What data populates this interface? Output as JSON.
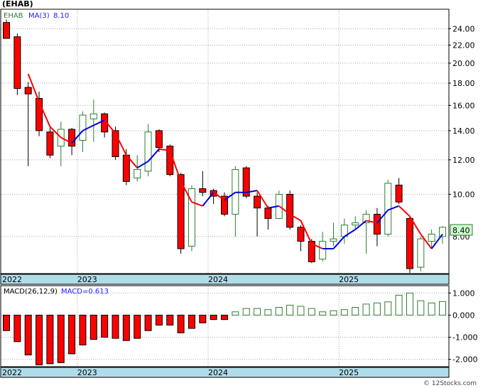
{
  "header": {
    "ticker_title": "(EHAB)"
  },
  "watermark": "© 12Stocks.com",
  "colors": {
    "up_stroke": "#2e7d32",
    "down_fill": "#ff0000",
    "ma_down": "#ff0000",
    "ma_up": "#0000dd",
    "axis_band": "#b0dcea",
    "macd_label": "#1a1aff"
  },
  "chart_data": [
    {
      "type": "candlestick",
      "legend": {
        "symbol": "EHAB",
        "ma_label": "MA(3)",
        "ma_value": "8.10"
      },
      "y_scale": "log",
      "ylim": [
        6.6,
        26.5
      ],
      "yticks": [
        "24.00",
        "22.00",
        "20.00",
        "18.00",
        "16.00",
        "14.00",
        "12.00",
        "10.00"
      ],
      "ytick_values": [
        24,
        22,
        20,
        18,
        16,
        14,
        12,
        10
      ],
      "last_price_label": "8.40",
      "last_price": 8.4,
      "partially_hidden_tick": "8.00",
      "x_labels": [
        {
          "label": "2022",
          "month_index": 0
        },
        {
          "label": "2023",
          "month_index": 7
        },
        {
          "label": "2024",
          "month_index": 19
        },
        {
          "label": "2025",
          "month_index": 31
        }
      ],
      "candles": [
        {
          "o": 24.8,
          "h": 25.2,
          "l": 22.9,
          "c": 22.8,
          "ma": null
        },
        {
          "o": 23.0,
          "h": 23.4,
          "l": 16.9,
          "c": 17.5,
          "ma": null
        },
        {
          "o": 17.6,
          "h": 18.1,
          "l": 11.6,
          "c": 17.0,
          "ma": 18.9
        },
        {
          "o": 16.6,
          "h": 17.2,
          "l": 13.6,
          "c": 14.0,
          "ma": 16.3
        },
        {
          "o": 13.9,
          "h": 14.3,
          "l": 12.1,
          "c": 12.3,
          "ma": 14.3
        },
        {
          "o": 12.9,
          "h": 14.7,
          "l": 11.6,
          "c": 14.1,
          "ma": 13.5
        },
        {
          "o": 14.1,
          "h": 14.2,
          "l": 12.3,
          "c": 12.9,
          "ma": 13.1
        },
        {
          "o": 13.3,
          "h": 15.5,
          "l": 12.5,
          "c": 15.2,
          "ma": 14.0
        },
        {
          "o": 14.9,
          "h": 16.5,
          "l": 13.2,
          "c": 15.3,
          "ma": 14.4
        },
        {
          "o": 15.3,
          "h": 15.4,
          "l": 13.5,
          "c": 13.9,
          "ma": 14.8
        },
        {
          "o": 14.0,
          "h": 14.3,
          "l": 12.0,
          "c": 12.2,
          "ma": 13.8
        },
        {
          "o": 12.3,
          "h": 12.7,
          "l": 10.5,
          "c": 10.7,
          "ma": 12.3
        },
        {
          "o": 10.9,
          "h": 12.3,
          "l": 10.7,
          "c": 11.4,
          "ma": 11.5
        },
        {
          "o": 11.3,
          "h": 14.5,
          "l": 11.0,
          "c": 13.9,
          "ma": 11.9
        },
        {
          "o": 14.0,
          "h": 14.1,
          "l": 12.5,
          "c": 12.8,
          "ma": 12.7
        },
        {
          "o": 12.9,
          "h": 13.0,
          "l": 11.0,
          "c": 11.1,
          "ma": 12.6
        },
        {
          "o": 11.1,
          "h": 11.2,
          "l": 7.3,
          "c": 7.5,
          "ma": 10.7
        },
        {
          "o": 7.6,
          "h": 10.5,
          "l": 7.4,
          "c": 10.3,
          "ma": 9.6
        },
        {
          "o": 10.3,
          "h": 11.3,
          "l": 9.9,
          "c": 10.1,
          "ma": 9.4
        },
        {
          "o": 10.2,
          "h": 10.3,
          "l": 9.5,
          "c": 9.9,
          "ma": 10.1
        },
        {
          "o": 9.9,
          "h": 10.1,
          "l": 8.9,
          "c": 9.0,
          "ma": 9.7
        },
        {
          "o": 9.0,
          "h": 11.6,
          "l": 8.0,
          "c": 11.4,
          "ma": 10.1
        },
        {
          "o": 11.5,
          "h": 11.6,
          "l": 9.8,
          "c": 9.9,
          "ma": 10.1
        },
        {
          "o": 9.9,
          "h": 10.1,
          "l": 8.0,
          "c": 9.3,
          "ma": 10.2
        },
        {
          "o": 9.3,
          "h": 9.4,
          "l": 8.3,
          "c": 8.8,
          "ma": 9.3
        },
        {
          "o": 8.8,
          "h": 10.2,
          "l": 8.8,
          "c": 10.0,
          "ma": 9.4
        },
        {
          "o": 10.0,
          "h": 10.2,
          "l": 8.3,
          "c": 8.4,
          "ma": 9.0
        },
        {
          "o": 8.4,
          "h": 8.5,
          "l": 7.4,
          "c": 7.8,
          "ma": 8.7
        },
        {
          "o": 7.8,
          "h": 7.9,
          "l": 6.95,
          "c": 7.0,
          "ma": 7.7
        },
        {
          "o": 7.1,
          "h": 8.2,
          "l": 7.0,
          "c": 7.8,
          "ma": 7.5
        },
        {
          "o": 7.8,
          "h": 8.6,
          "l": 7.6,
          "c": 7.9,
          "ma": 7.5
        },
        {
          "o": 8.0,
          "h": 8.8,
          "l": 7.7,
          "c": 8.5,
          "ma": 8.0
        },
        {
          "o": 8.5,
          "h": 8.9,
          "l": 8.3,
          "c": 8.6,
          "ma": 8.3
        },
        {
          "o": 8.6,
          "h": 9.2,
          "l": 7.3,
          "c": 9.0,
          "ma": 8.7
        },
        {
          "o": 9.0,
          "h": 9.3,
          "l": 7.6,
          "c": 8.1,
          "ma": 8.6
        },
        {
          "o": 8.1,
          "h": 10.8,
          "l": 8.0,
          "c": 10.6,
          "ma": 9.2
        },
        {
          "o": 10.5,
          "h": 10.9,
          "l": 9.5,
          "c": 9.6,
          "ma": 9.4
        },
        {
          "o": 8.8,
          "h": 8.9,
          "l": 6.6,
          "c": 6.75,
          "ma": 8.9
        },
        {
          "o": 6.8,
          "h": 8.0,
          "l": 6.65,
          "c": 7.9,
          "ma": 8.1
        },
        {
          "o": 7.8,
          "h": 8.3,
          "l": 7.5,
          "c": 8.1,
          "ma": 7.5
        },
        {
          "o": 8.0,
          "h": 8.45,
          "l": 7.7,
          "c": 8.4,
          "ma": 8.1
        }
      ]
    },
    {
      "type": "bar",
      "legend": {
        "label": "MACD(26,12,9)",
        "value_label": "MACD=0.613"
      },
      "ylim": [
        -2.3,
        1.3
      ],
      "yticks": [
        "1.000",
        "0.000",
        "-1.000",
        "-2.000"
      ],
      "ytick_values": [
        1,
        0,
        -1,
        -2
      ],
      "x_labels": [
        {
          "label": "2022",
          "month_index": 0
        },
        {
          "label": "2023",
          "month_index": 7
        },
        {
          "label": "2024",
          "month_index": 19
        },
        {
          "label": "2025",
          "month_index": 31
        }
      ],
      "values": [
        -0.7,
        -1.2,
        -1.8,
        -2.25,
        -2.2,
        -2.15,
        -1.75,
        -1.35,
        -1.1,
        -1.0,
        -1.05,
        -1.15,
        -1.05,
        -0.7,
        -0.45,
        -0.45,
        -0.8,
        -0.6,
        -0.35,
        -0.2,
        -0.2,
        0.15,
        0.3,
        0.3,
        0.25,
        0.35,
        0.45,
        0.4,
        0.3,
        0.15,
        0.2,
        0.25,
        0.35,
        0.5,
        0.55,
        0.6,
        0.9,
        1.0,
        0.65,
        0.55,
        0.613
      ]
    }
  ]
}
